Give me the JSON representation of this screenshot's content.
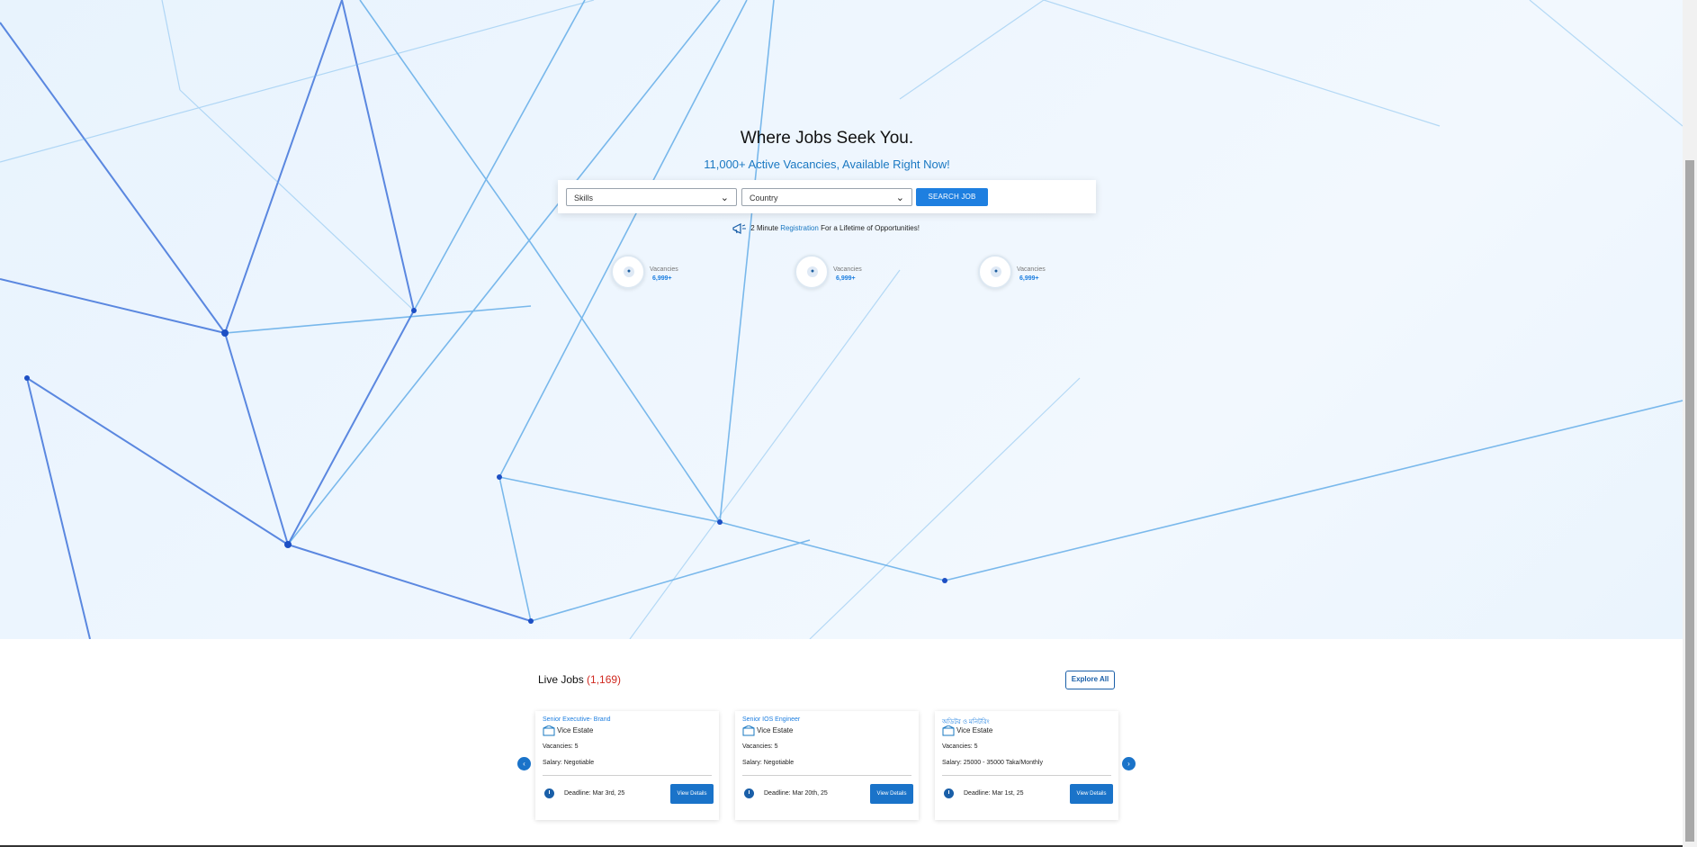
{
  "hero": {
    "title": "Where Jobs Seek You.",
    "subtitle": "11,000+ Active Vacancies, Available Right Now!",
    "search": {
      "skills_value": "Skills",
      "country_value": "Country",
      "button_label": "SEARCH JOB"
    },
    "registration": {
      "prefix": "2 Minute ",
      "link": "Registration",
      "suffix": " For a Lifetime of Opportunities!"
    },
    "stats": [
      {
        "label": "Vacancies",
        "value": "6,999+"
      },
      {
        "label": "Vacancies",
        "value": "6,999+"
      },
      {
        "label": "Vacancies",
        "value": "6,999+"
      }
    ]
  },
  "live_jobs": {
    "title": "Live Jobs ",
    "count": "(1,169)",
    "explore_label": "Explore All",
    "prev_arrow": "‹",
    "next_arrow": "›",
    "cards": [
      {
        "title": "Senior Executive- Brand",
        "company": "Vice Estate",
        "vacancies": "Vacancies: 5",
        "salary": "Salary: Negotiable",
        "deadline": "Deadline: Mar 3rd, 25",
        "button": "View Details"
      },
      {
        "title": "Senior IOS Engineer",
        "company": "Vice Estate",
        "vacancies": "Vacancies: 5",
        "salary": "Salary: Negotiable",
        "deadline": "Deadline: Mar 20th, 25",
        "button": "View Details"
      },
      {
        "title": "অডিটর ও মনিটরিং",
        "company": "Vice Estate",
        "vacancies": "Vacancies: 5",
        "salary": "Salary: 25000 - 35000 Taka/Monthly",
        "deadline": "Deadline: Mar 1st, 25",
        "button": "View Details"
      }
    ]
  },
  "colors": {
    "accent": "#1e7fe0",
    "count_red": "#d0281f",
    "hero_bg": "#eaf4fd"
  },
  "icons": {
    "search_skills_chevron": "chevron-down-icon",
    "registration": "megaphone-icon",
    "stat": "user-icon",
    "company": "building-icon",
    "deadline": "clock-icon",
    "carousel_prev": "arrow-left-icon",
    "carousel_next": "arrow-right-icon"
  }
}
